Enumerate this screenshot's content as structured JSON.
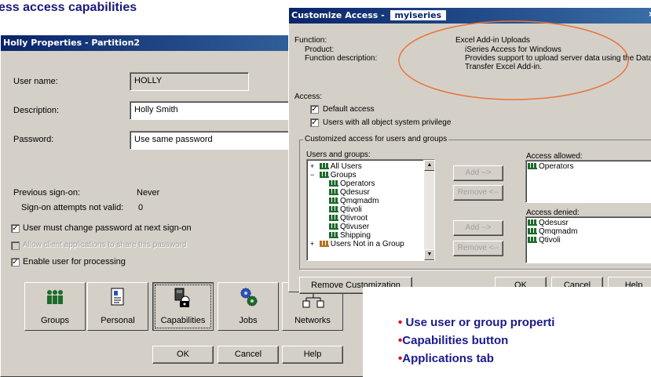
{
  "slide": {
    "title": "ess access capabilities",
    "bullets": [
      {
        "dot": "•",
        "text": "Use user or group properti"
      },
      {
        "dot": "•",
        "text": "Capabilities button"
      },
      {
        "dot": "•",
        "text": "Applications tab"
      }
    ]
  },
  "props_dialog": {
    "title": "Holly Properties - Partition2",
    "user_name_label": "User name:",
    "user_name_value": "HOLLY",
    "description_label": "Description:",
    "description_value": "Holly Smith",
    "password_label": "Password:",
    "password_value": "Use same password",
    "prev_signon_label": "Previous sign-on:",
    "prev_signon_value": "Never",
    "signon_attempts_label": "Sign-on attempts not valid:",
    "signon_attempts_value": "0",
    "checkboxes": [
      {
        "label": "User must change password at next sign-on",
        "checked": true,
        "enabled": true
      },
      {
        "label": "Allow client applications to share this password",
        "checked": false,
        "enabled": false
      },
      {
        "label": "Enable user for processing",
        "checked": true,
        "enabled": true
      }
    ],
    "big_buttons": [
      {
        "label": "Groups",
        "icon": "groups-icon"
      },
      {
        "label": "Personal",
        "icon": "personal-icon"
      },
      {
        "label": "Capabilities",
        "icon": "capabilities-icon"
      },
      {
        "label": "Jobs",
        "icon": "jobs-icon"
      },
      {
        "label": "Networks",
        "icon": "networks-icon"
      }
    ],
    "ok_label": "OK",
    "cancel_label": "Cancel",
    "help_label": "Help"
  },
  "customize_dialog": {
    "title": "Customize Access -",
    "title_tag": "myiseries",
    "close_glyph": "×",
    "function_label": "Function:",
    "function_value": "Excel Add-in Uploads",
    "product_label": "Product:",
    "product_value": "iSeries Access for Windows",
    "func_desc_label": "Function description:",
    "func_desc_value1": "Provides support to upload server data using the Data",
    "func_desc_value2": "Transfer Excel Add-in.",
    "access_label": "Access:",
    "default_access_label": "Default access",
    "all_obj_label": "Users with all object system privilege",
    "customized_group_label": "Customized access for users and groups",
    "users_groups_label": "Users and groups:",
    "tree": [
      {
        "label": "All Users",
        "indent": 0,
        "expander": "+"
      },
      {
        "label": "Groups",
        "indent": 0,
        "expander": "−"
      },
      {
        "label": "Operators",
        "indent": 1
      },
      {
        "label": "Qdesusr",
        "indent": 1
      },
      {
        "label": "Qmqmadm",
        "indent": 1
      },
      {
        "label": "Qtivoli",
        "indent": 1
      },
      {
        "label": "Qtivroot",
        "indent": 1
      },
      {
        "label": "Qtivuser",
        "indent": 1
      },
      {
        "label": "Shipping",
        "indent": 1
      },
      {
        "label": "Users Not in a Group",
        "indent": 0,
        "expander": "+"
      }
    ],
    "add_label": "Add -->",
    "remove_label": "Remove <--",
    "allowed_label": "Access allowed:",
    "allowed_items": [
      "Operators"
    ],
    "denied_label": "Access denied:",
    "denied_items": [
      "Qdesusr",
      "Qmqmadm",
      "Qtivoli"
    ],
    "remove_customization_label": "Remove Customization",
    "ok_label": "OK",
    "cancel_label": "Cancel",
    "help_label": "Help"
  },
  "colors": {
    "title_bar": "#0a246a",
    "highlight_ellipse": "#e8743b",
    "bullet_text": "#1a1a8c",
    "bullet_dot": "#e00000"
  }
}
